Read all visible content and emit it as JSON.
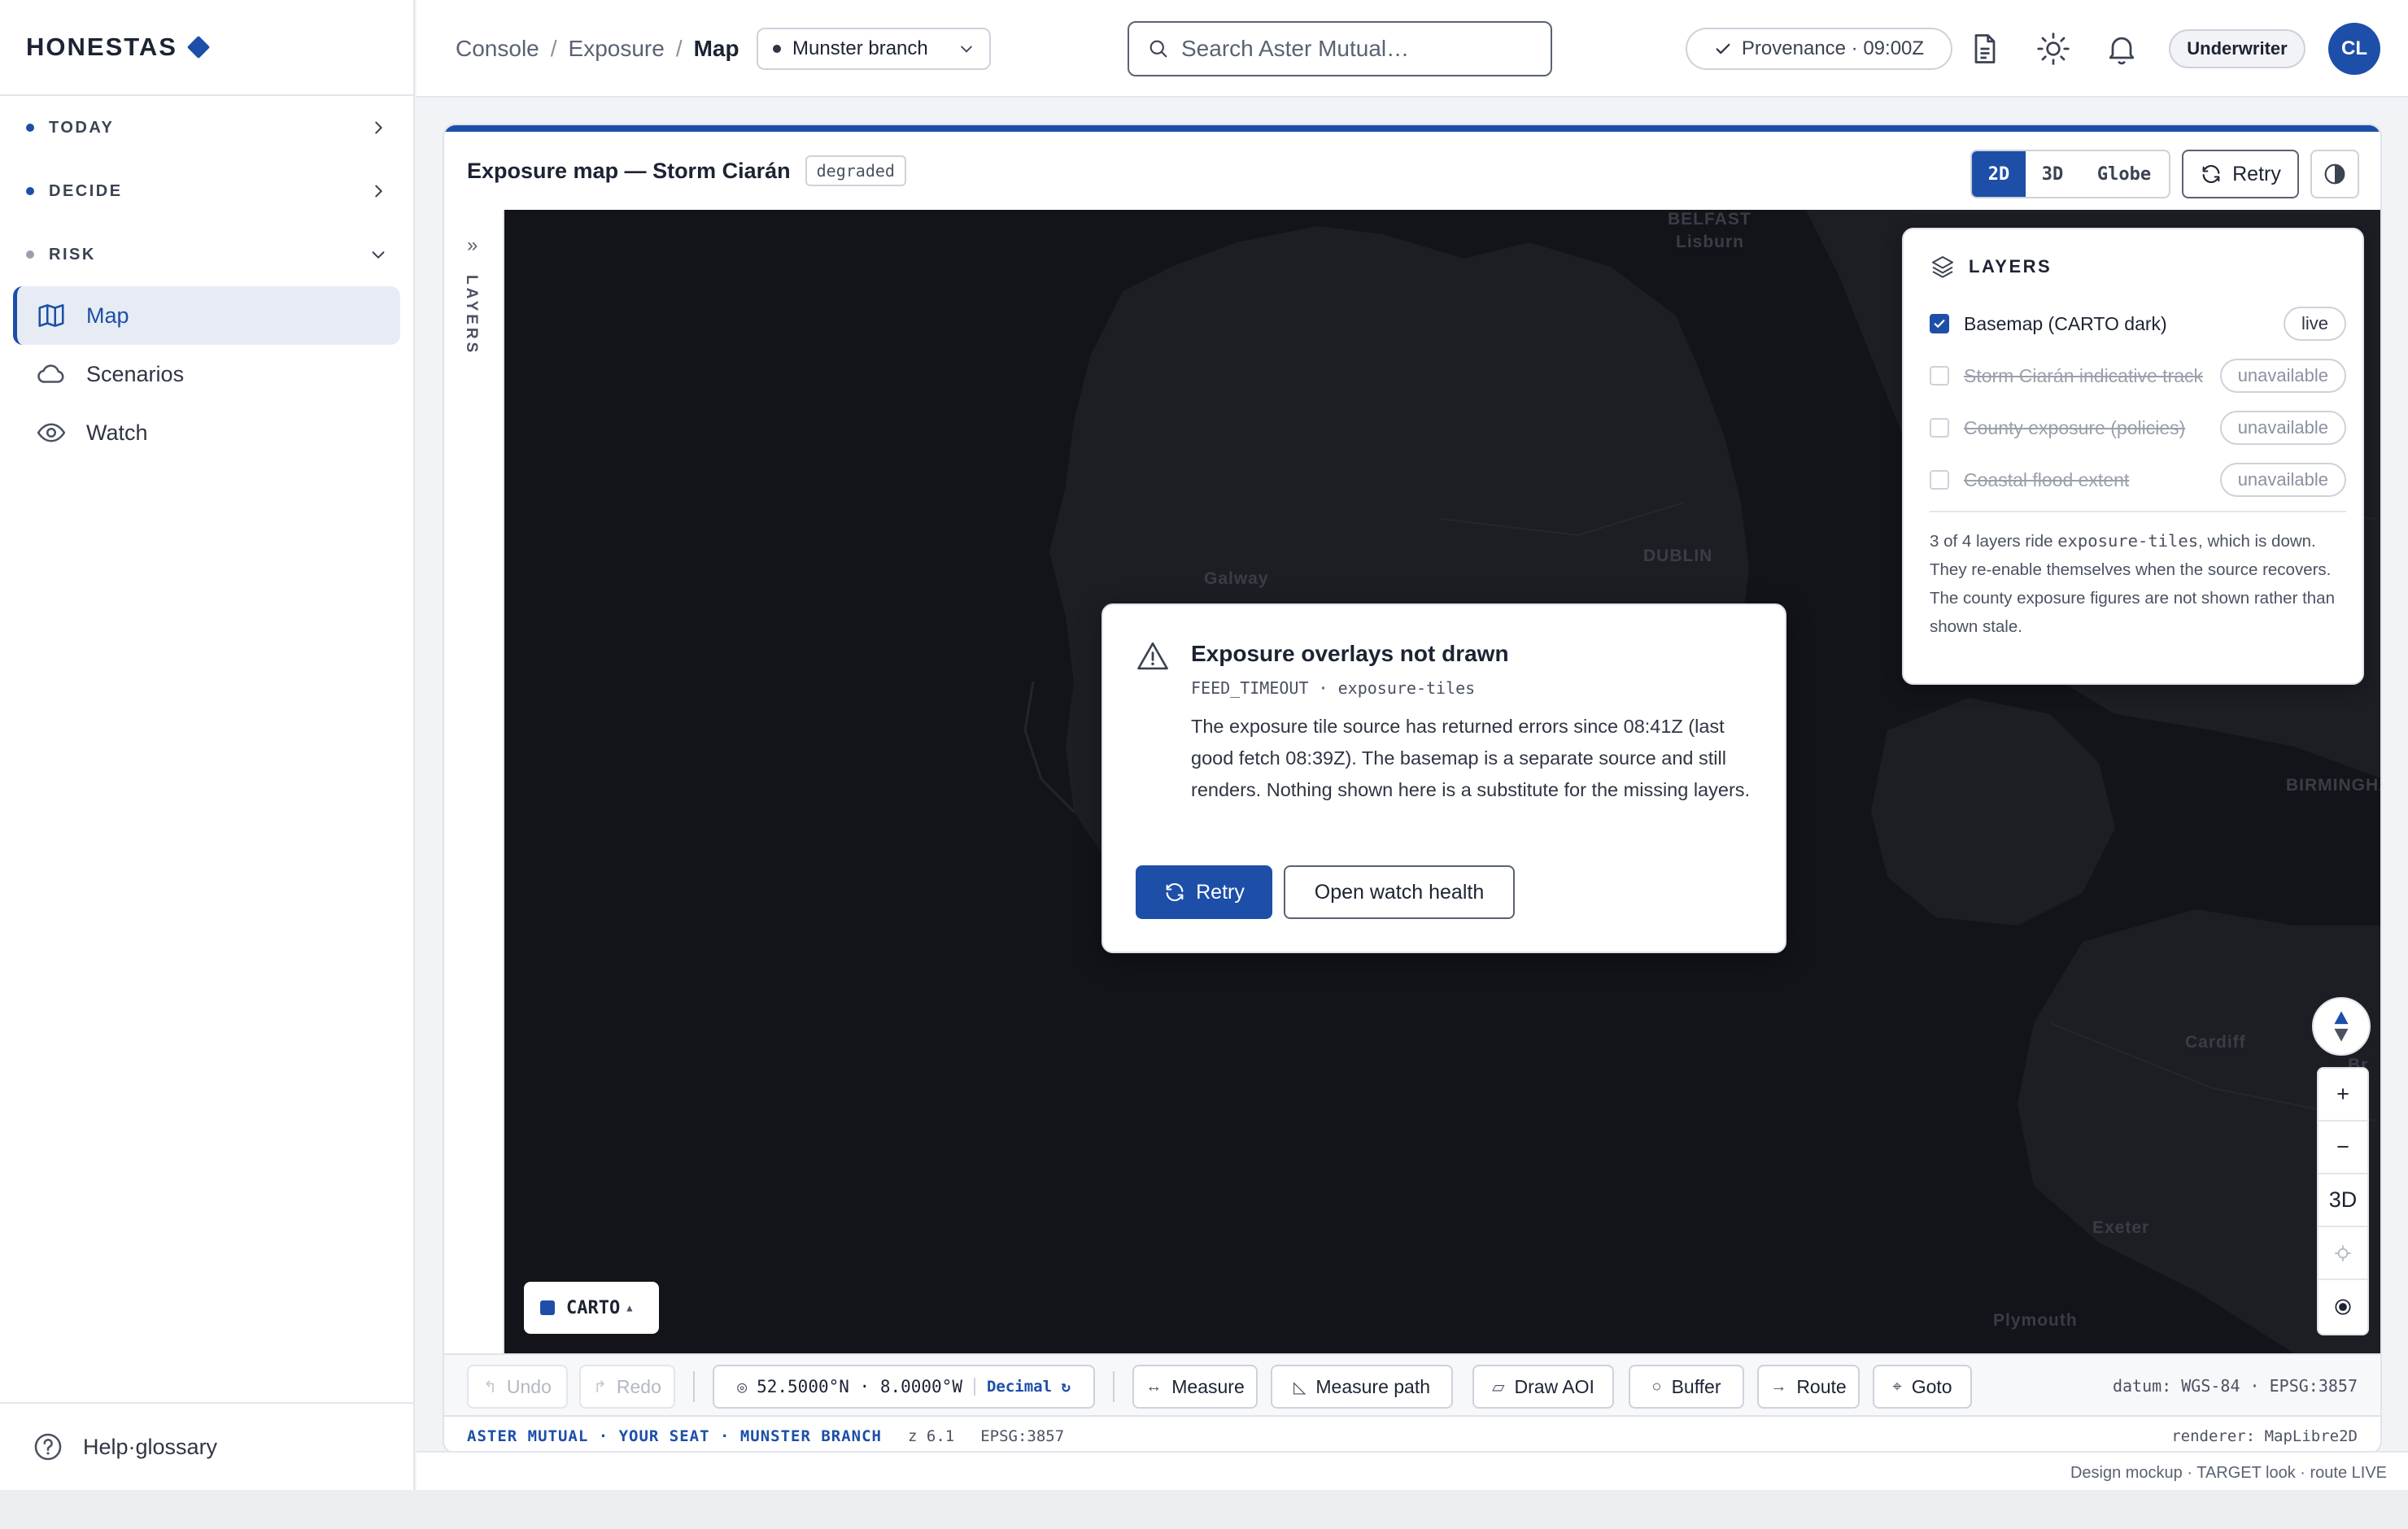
{
  "brand": {
    "name": "HONESTAS"
  },
  "sidebar": {
    "sections": [
      {
        "label": "TODAY",
        "dot_color": "#1d4fa8",
        "expanded": false
      },
      {
        "label": "DECIDE",
        "dot_color": "#1d4fa8",
        "expanded": false
      },
      {
        "label": "RISK",
        "dot_color": "#9aa0ab",
        "expanded": true
      }
    ],
    "items": [
      {
        "label": "Map",
        "icon": "map-icon",
        "active": true
      },
      {
        "label": "Scenarios",
        "icon": "cloud-icon",
        "active": false
      },
      {
        "label": "Watch",
        "icon": "eye-icon",
        "active": false
      }
    ],
    "footer": {
      "label": "Help·glossary",
      "icon": "help-icon"
    }
  },
  "topbar": {
    "breadcrumb": [
      "Console",
      "Exposure",
      "Map"
    ],
    "branch": "Munster branch",
    "search_placeholder": "Search Aster Mutual…",
    "provenance": "Provenance · 09:00Z",
    "role": "Underwriter",
    "avatar_initials": "CL"
  },
  "card": {
    "title": "Exposure map — Storm Ciarán",
    "status_badge": "degraded",
    "view_modes": [
      "2D",
      "3D",
      "Globe"
    ],
    "active_view": "2D",
    "retry_label": "Retry"
  },
  "rail": {
    "label": "LAYERS",
    "expand": "»"
  },
  "map": {
    "cities": [
      "BELFAST",
      "Lisburn",
      "DUBLIN",
      "Galway",
      "BIRMINGHAM",
      "Cardiff",
      "Exeter",
      "Plymouth",
      "Br"
    ],
    "basemap_chip": "CARTO",
    "zoom_in": "+",
    "zoom_out": "−",
    "mode_3d": "3D"
  },
  "alert": {
    "title": "Exposure overlays not drawn",
    "code": "FEED_TIMEOUT · exposure-tiles",
    "body": "The exposure tile source has returned errors since 08:41Z (last good fetch 08:39Z). The basemap is a separate source and still renders. Nothing shown here is a substitute for the missing layers.",
    "primary": "Retry",
    "secondary": "Open watch health"
  },
  "layers": {
    "title": "LAYERS",
    "rows": [
      {
        "name": "Basemap (CARTO dark)",
        "checked": true,
        "status": "live"
      },
      {
        "name": "Storm Ciarán indicative track",
        "checked": false,
        "status": "unavailable"
      },
      {
        "name": "County exposure (policies)",
        "checked": false,
        "status": "unavailable"
      },
      {
        "name": "Coastal flood extent",
        "checked": false,
        "status": "unavailable"
      }
    ],
    "note_pre": "3 of 4 layers ride ",
    "note_code": "exposure-tiles",
    "note_post": ", which is down. They re-enable themselves when the source recovers. The county exposure figures are not shown rather than shown stale."
  },
  "toolbar": {
    "undo": "Undo",
    "redo": "Redo",
    "coords": "52.5000°N · 8.0000°W",
    "coord_format": "Decimal ↻",
    "tools": [
      "Measure",
      "Measure path",
      "Draw AOI",
      "Buffer",
      "Route",
      "Goto"
    ],
    "datum": "datum: WGS-84 · EPSG:3857"
  },
  "statusbar": {
    "org": "ASTER MUTUAL · YOUR SEAT · MUNSTER BRANCH",
    "zoom": "z 6.1",
    "epsg": "EPSG:3857",
    "renderer": "renderer: MapLibre2D"
  },
  "footer": {
    "note": "Design mockup · TARGET look · route LIVE"
  },
  "colors": {
    "accent": "#1d4fa8",
    "map_bg": "#131419",
    "land": "#1d1e24"
  }
}
